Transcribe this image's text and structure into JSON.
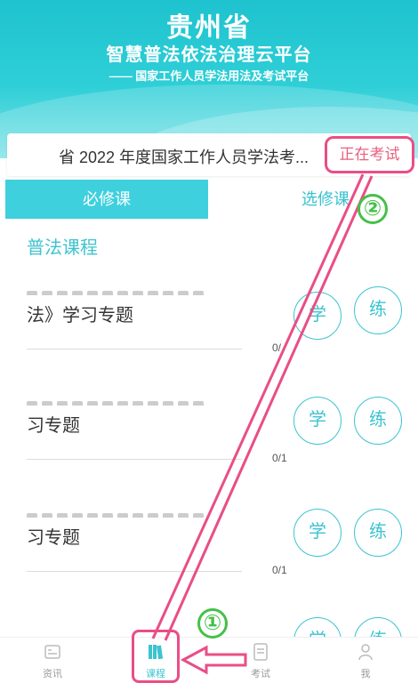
{
  "header": {
    "province": "贵州省",
    "platform": "智慧普法依法治理云平台",
    "subtitle": "—— 国家工作人员学法用法及考试平台"
  },
  "banner": {
    "exam_text": "省 2022 年度国家工作人员学法考...",
    "status_label": "正在考试"
  },
  "tabs": {
    "required": "必修课",
    "elective": "选修课"
  },
  "section_title": "普法课程",
  "courses": [
    {
      "name": "法》学习专题",
      "progress": "0/",
      "study_label": "学",
      "practice_label": "练"
    },
    {
      "name": "习专题",
      "progress": "0/1",
      "study_label": "学",
      "practice_label": "练"
    },
    {
      "name": "习专题",
      "progress": "0/1",
      "study_label": "学",
      "practice_label": "练"
    },
    {
      "name": "",
      "progress": "",
      "study_label": "学",
      "practice_label": "练"
    }
  ],
  "bottom_nav": [
    {
      "label": "资讯",
      "icon": "news-icon"
    },
    {
      "label": "课程",
      "icon": "course-icon"
    },
    {
      "label": "考试",
      "icon": "exam-icon"
    },
    {
      "label": "我",
      "icon": "user-icon"
    }
  ],
  "annotations": {
    "step1": "①",
    "step2": "②",
    "highlight_color": "#e94e86",
    "number_color": "#45c04a"
  },
  "colors": {
    "accent": "#3cc3d0",
    "header_bg": "#1ec3cf"
  }
}
